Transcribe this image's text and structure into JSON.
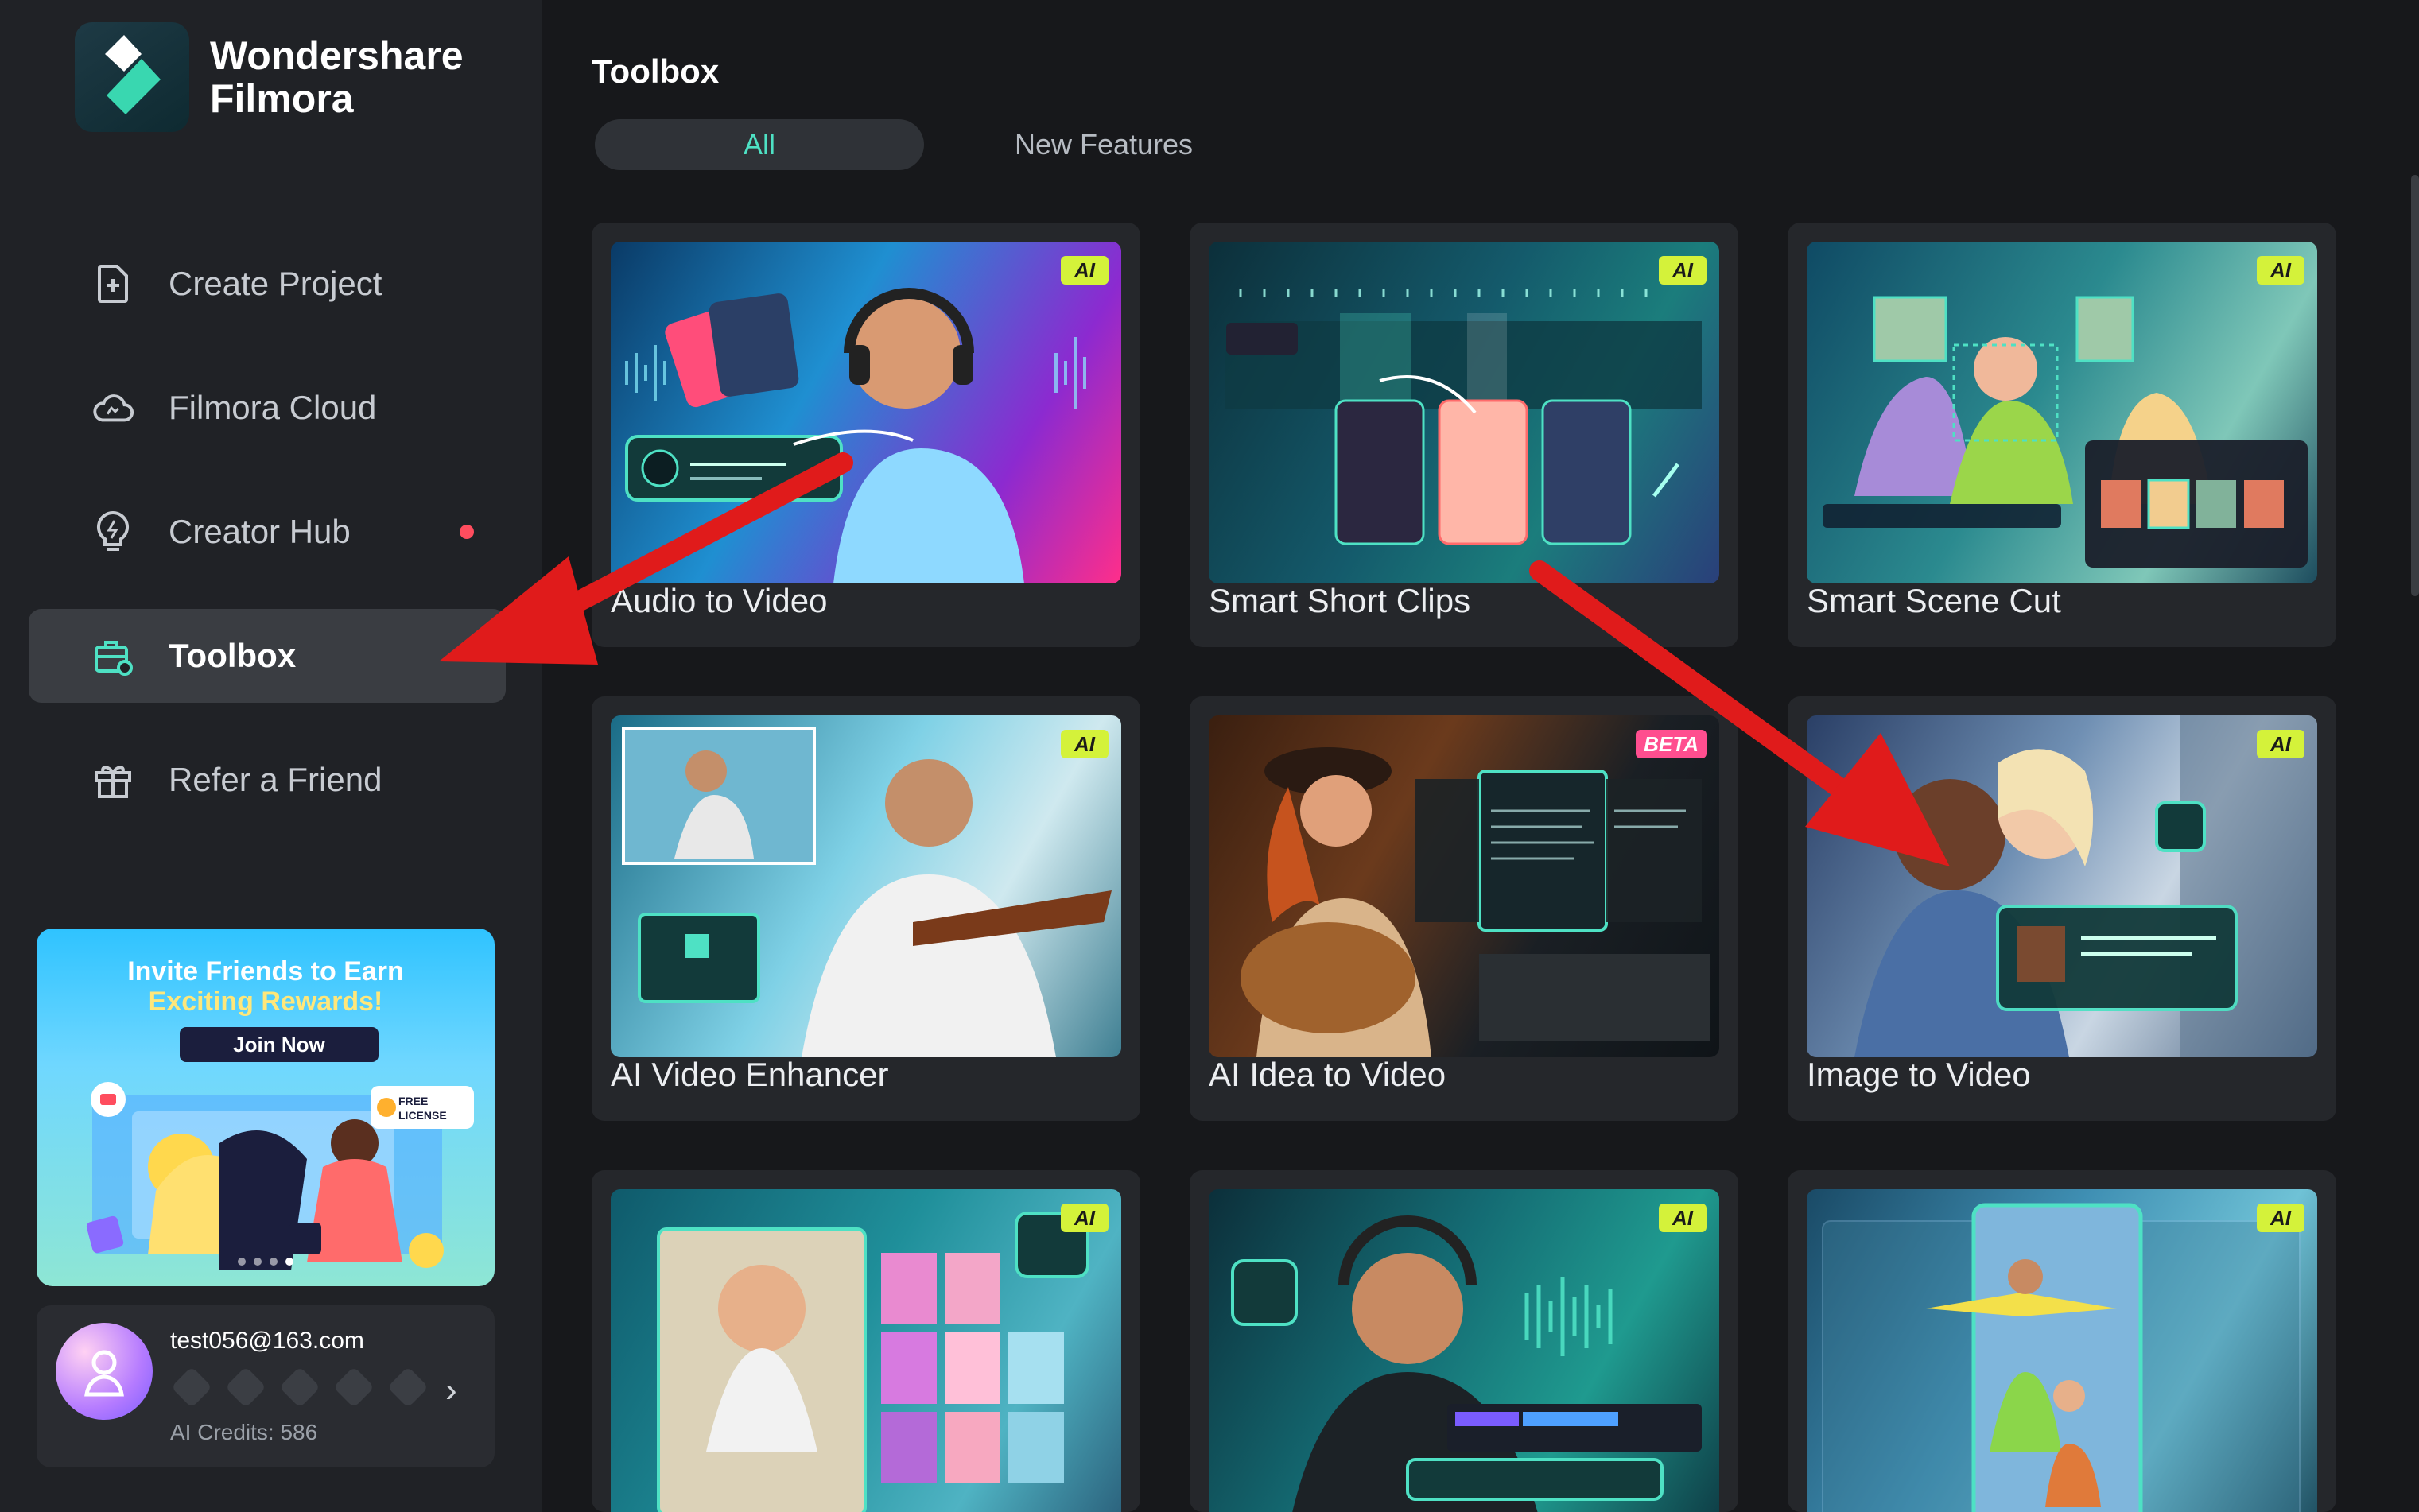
{
  "brand": {
    "line1": "Wondershare",
    "line2": "Filmora"
  },
  "sidebar": {
    "items": [
      {
        "label": "Create Project",
        "icon": "plus-file-icon"
      },
      {
        "label": "Filmora Cloud",
        "icon": "cloud-icon"
      },
      {
        "label": "Creator Hub",
        "icon": "lightbulb-icon",
        "has_dot": true
      },
      {
        "label": "Toolbox",
        "icon": "toolbox-icon",
        "active": true
      },
      {
        "label": "Refer a Friend",
        "icon": "gift-icon"
      }
    ],
    "promo": {
      "line1": "Invite Friends to Earn",
      "line2": "Exciting Rewards!",
      "button": "Join Now",
      "badge": "FREE LICENSE"
    },
    "account": {
      "email": "test056@163.com",
      "credits": "AI Credits: 586"
    }
  },
  "main": {
    "title": "Toolbox",
    "tabs": [
      {
        "label": "All",
        "active": true
      },
      {
        "label": "New Features",
        "active": false
      }
    ],
    "cards": [
      {
        "label": "Audio to Video",
        "tag": "AI"
      },
      {
        "label": "Smart Short Clips",
        "tag": "AI"
      },
      {
        "label": "Smart Scene Cut",
        "tag": "AI"
      },
      {
        "label": "AI Video Enhancer",
        "tag": "AI"
      },
      {
        "label": "AI Idea to Video",
        "tag": "BETA"
      },
      {
        "label": "Image to Video",
        "tag": "AI"
      },
      {
        "label": "",
        "tag": "AI"
      },
      {
        "label": "",
        "tag": "AI"
      },
      {
        "label": "",
        "tag": "AI"
      }
    ]
  },
  "colors": {
    "accent": "#4ee1c4",
    "sidebar_bg": "#202226",
    "main_bg": "#17181b",
    "ai_tag": "#d4f23a",
    "beta_tag": "#ff4e8f",
    "annotation_arrow": "#e01b1b"
  }
}
